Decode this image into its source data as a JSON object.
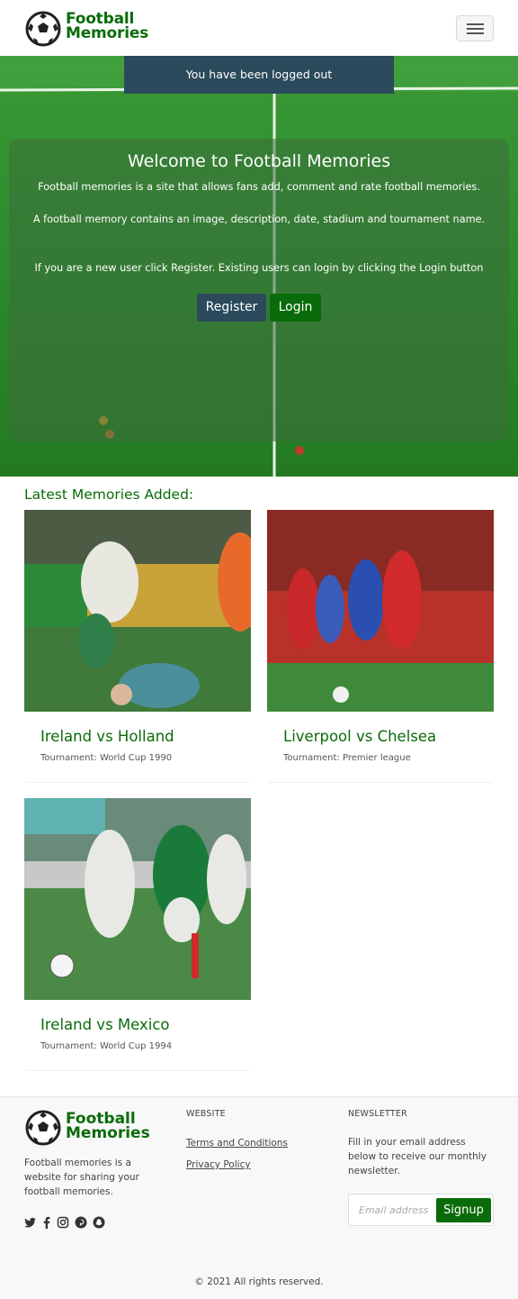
{
  "header": {
    "brand_line1": "Football",
    "brand_line2": "Memories",
    "menu_icon": "hamburger-icon"
  },
  "flash": {
    "message": "You have been logged out"
  },
  "hero": {
    "title": "Welcome to Football Memories",
    "p1": "Football memories is a site that allows fans add, comment and rate football memories.",
    "p2": "A football memory contains an image, description, date, stadium and tournament name.",
    "p3": "If you are a new user click Register. Existing users can login by clicking the Login button",
    "register_label": "Register",
    "login_label": "Login"
  },
  "memories": {
    "title": "Latest Memories Added:",
    "cards": [
      {
        "title": "Ireland vs Holland",
        "tournament": "Tournament: World Cup 1990"
      },
      {
        "title": "Liverpool vs Chelsea",
        "tournament": "Tournament: Premier league"
      },
      {
        "title": "Ireland vs Mexico",
        "tournament": "Tournament: World Cup 1994"
      }
    ]
  },
  "footer": {
    "brand_line1": "Football",
    "brand_line2": "Memories",
    "description": "Football memories is a website for sharing your football memories.",
    "social_icons": [
      "twitter-icon",
      "facebook-icon",
      "instagram-icon",
      "pinterest-icon",
      "snapchat-icon"
    ],
    "website_heading": "WEBSITE",
    "links": [
      "Terms and Conditions",
      "Privacy Policy"
    ],
    "newsletter_heading": "NEWSLETTER",
    "newsletter_text": "Fill in your email address below to receive our monthly newsletter.",
    "email_placeholder": "Email address",
    "signup_label": "Signup",
    "copyright": "© 2021 All rights reserved."
  },
  "colors": {
    "brand_green": "#0a6b0a",
    "navy": "#2b4a5b",
    "pitch_green": "#2f8a2a"
  }
}
